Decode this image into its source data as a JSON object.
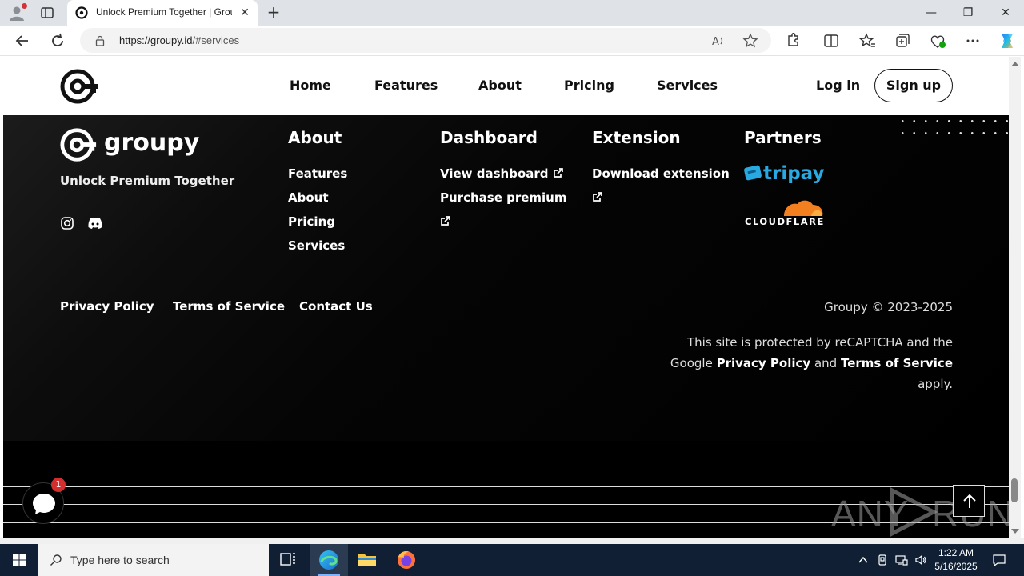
{
  "browser": {
    "tab_title": "Unlock Premium Together | Groupy",
    "url_host": "https://groupy.id",
    "url_path": "/#services"
  },
  "site": {
    "nav": [
      "Home",
      "Features",
      "About",
      "Pricing",
      "Services"
    ],
    "login": "Log in",
    "signup": "Sign up"
  },
  "footer": {
    "brand": "groupy",
    "tagline": "Unlock Premium Together",
    "columns": {
      "about": {
        "title": "About",
        "links": [
          "Features",
          "About",
          "Pricing",
          "Services"
        ]
      },
      "dashboard": {
        "title": "Dashboard",
        "links": [
          "View dashboard",
          "Purchase premium"
        ]
      },
      "extension": {
        "title": "Extension",
        "links": [
          "Download extension"
        ]
      },
      "partners": {
        "title": "Partners",
        "names": [
          "tripay",
          "CLOUDFLARE"
        ]
      }
    },
    "legal": [
      "Privacy Policy",
      "Terms of Service",
      "Contact Us"
    ],
    "copyright": "Groupy © 2023-2025",
    "recaptcha": {
      "pre": "This site is protected by reCAPTCHA and the Google",
      "privacy": "Privacy Policy",
      "and": "and",
      "terms": "Terms of Service",
      "post": "apply."
    }
  },
  "chat": {
    "badge": "1"
  },
  "watermark": {
    "left": "ANY",
    "right": "RUN"
  },
  "taskbar": {
    "search_placeholder": "Type here to search",
    "time": "1:22 AM",
    "date": "5/16/2025"
  },
  "colors": {
    "tab_accent": "#dfe3e8",
    "taskbar": "#101f33",
    "badge": "#d32f2f"
  }
}
